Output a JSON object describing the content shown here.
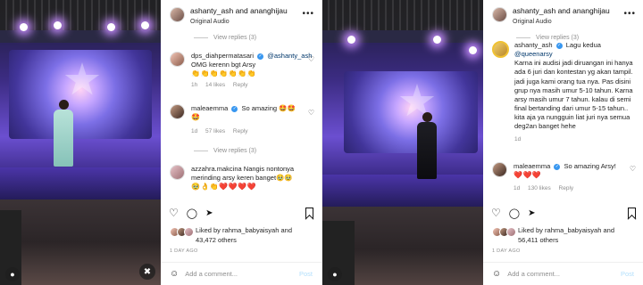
{
  "left": {
    "header": {
      "title": "ashanty_ash and ananghijau",
      "subtitle": "Original Audio",
      "more": "•••"
    },
    "view_replies_top": "View replies (3)",
    "comments": [
      {
        "user": "dps_diahpermatasari",
        "mention": "@ashanty_ash",
        "text": "OMG kerenn bgt Arsy",
        "emojis": "👏👏👏👏👏👏👏",
        "age": "1h",
        "likes": "14 likes",
        "reply": "Reply"
      },
      {
        "user": "maleaemma",
        "text": "So amazing 🤩🤩",
        "emojis": "🤩",
        "age": "1d",
        "likes": "57 likes",
        "reply": "Reply"
      },
      {
        "user": "azzahra.makcina",
        "text": "Nangis nontonya merinding arsy keren banget🥹🥹",
        "emojis": "🥹👌👏❤️❤️❤️❤️"
      }
    ],
    "view_replies_mid": "View replies (3)",
    "liked_by_prefix": "Liked by",
    "liked_by_user": "rahma_babyaisyah",
    "liked_by_and": "and",
    "liked_by_count": "43,472 others",
    "time": "1 DAY AGO",
    "add_comment": "Add a comment...",
    "post": "Post"
  },
  "right": {
    "header": {
      "title": "ashanty_ash and ananghijau",
      "subtitle": "Original Audio",
      "more": "•••"
    },
    "view_replies_top": "View replies (3)",
    "caption": {
      "user": "ashanty_ash",
      "first_line": "Lagu kedua",
      "mention": "@queenarsy",
      "text": "Karna ini audisi jadi diruangan ini hanya ada 6 juri dan kontestan yg akan tampil. jadi juga kami orang tua nya. Pas disini grup nya masih umur 5-10 tahun. Karna arsy masih umur 7 tahun. kalau di semi final bertanding dari umur 5-15 tahun.. kita aja ya nungguin liat juri nya semua deg2an banget hehe",
      "age": "1d"
    },
    "comment": {
      "user": "maleaemma",
      "text": "So amazing Arsy!",
      "emojis": "❤️❤️❤️",
      "age": "1d",
      "likes": "130 likes",
      "reply": "Reply"
    },
    "liked_by_prefix": "Liked by",
    "liked_by_user": "rahma_babyaisyah",
    "liked_by_and": "and",
    "liked_by_count": "56,411 others",
    "time": "1 DAY AGO",
    "add_comment": "Add a comment...",
    "post": "Post"
  },
  "icons": {
    "heart": "♡",
    "comment": "◯",
    "share": "➤",
    "smile": "☺",
    "mute": "✖",
    "user": "●"
  }
}
